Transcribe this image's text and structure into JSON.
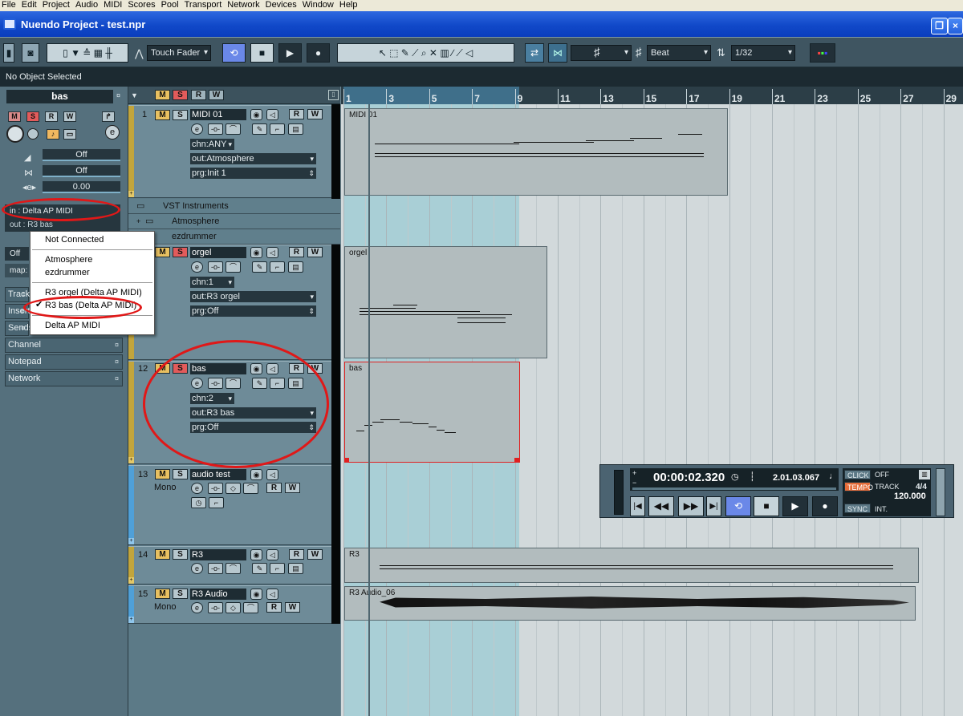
{
  "menu": [
    "File",
    "Edit",
    "Project",
    "Audio",
    "MIDI",
    "Scores",
    "Pool",
    "Transport",
    "Network",
    "Devices",
    "Window",
    "Help"
  ],
  "window": {
    "title": "Nuendo Project - test.npr"
  },
  "toolbar": {
    "automation_mode": "Touch Fader",
    "snap_mode": "Beat",
    "quantize": "1/32",
    "grid_symbol": "♯"
  },
  "info_line": "No Object Selected",
  "inspector": {
    "track_name": "bas",
    "buttons": {
      "m": "M",
      "s": "S",
      "r": "R",
      "w": "W"
    },
    "volume": "Off",
    "pan": "Off",
    "delay": "0.00",
    "input": "in :  Delta AP MIDI",
    "output": "out :  R3 bas",
    "prg_label": "Off",
    "map_label": "map:",
    "sections": [
      "Track",
      "Inserts",
      "Sends",
      "Channel",
      "Notepad",
      "Network"
    ]
  },
  "output_menu": {
    "items": [
      "Not Connected",
      "Atmosphere",
      "ezdrummer",
      "R3 orgel (Delta AP MIDI)",
      "R3 bas (Delta AP MIDI)",
      "Delta AP MIDI"
    ],
    "checked": "R3 bas (Delta AP MIDI)",
    "check_mark": "✔"
  },
  "tracklist_header": {
    "m": "M",
    "s": "S",
    "r": "R",
    "w": "W"
  },
  "tracks": [
    {
      "num": "1",
      "name": "MIDI 01",
      "chn": "chn:ANY",
      "out": "out:Atmosphere",
      "prg": "prg:Init 1"
    },
    {
      "num": "",
      "name": "orgel",
      "chn": "chn:1",
      "out": "out:R3 orgel",
      "prg": "prg:Off"
    },
    {
      "num": "12",
      "name": "bas",
      "chn": "chn:2",
      "out": "out:R3 bas",
      "prg": "prg:Off"
    },
    {
      "num": "13",
      "name": "audio test",
      "mono": "Mono"
    },
    {
      "num": "14",
      "name": "R3"
    },
    {
      "num": "15",
      "name": "R3 Audio",
      "mono": "Mono"
    }
  ],
  "folders": {
    "vst": "VST Instruments",
    "atmosphere": "Atmosphere",
    "ezdrummer": "ezdrummer"
  },
  "ruler": {
    "bars": [
      "1",
      "3",
      "5",
      "7",
      "9",
      "11",
      "13",
      "15",
      "17",
      "19",
      "21",
      "23",
      "25",
      "27",
      "29"
    ]
  },
  "parts": [
    {
      "label": "MIDI 01"
    },
    {
      "label": "orgel"
    },
    {
      "label": "bas"
    },
    {
      "label": "R3"
    },
    {
      "label": "R3 Audio_06"
    }
  ],
  "transport": {
    "time": "00:00:02.320",
    "bars": "2.01.03.067",
    "click": "CLICK",
    "click_value": "OFF",
    "tempo": "TEMPO",
    "tempo_mode": "TRACK",
    "signature": "4/4",
    "tempo_value": "120.000",
    "sync": "SYNC",
    "sync_value": "INT."
  },
  "colors": {
    "accent_red": "#e01818",
    "track_stripe": "#c2a53c",
    "cycle": "#a9cfd6"
  }
}
